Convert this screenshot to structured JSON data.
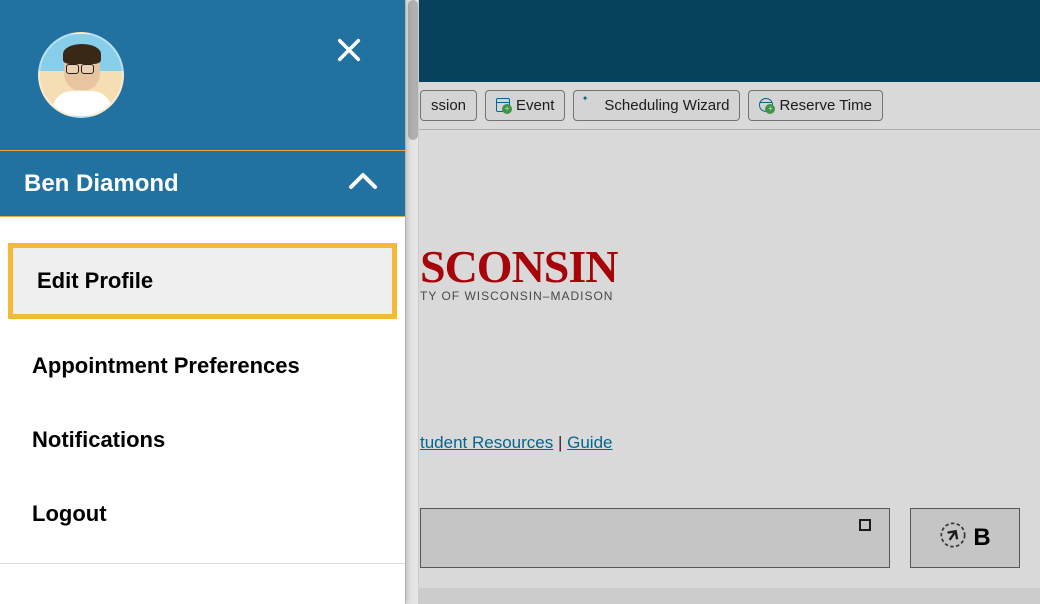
{
  "toolbar": {
    "btn_session": "ssion",
    "btn_event": "Event",
    "btn_wizard": "Scheduling Wizard",
    "btn_reserve": "Reserve Time"
  },
  "logo": {
    "text_fragment": "SCONSIN",
    "subtitle_fragment": "TY OF WISCONSIN–MADISON"
  },
  "resources": {
    "link_student": "tudent Resources",
    "link_guide": "Guide"
  },
  "lower": {
    "box_right_label": "B"
  },
  "sidebar": {
    "user_name": "Ben Diamond",
    "menu": {
      "edit_profile": "Edit Profile",
      "appointment_prefs": "Appointment Preferences",
      "notifications": "Notifications",
      "logout": "Logout"
    }
  }
}
